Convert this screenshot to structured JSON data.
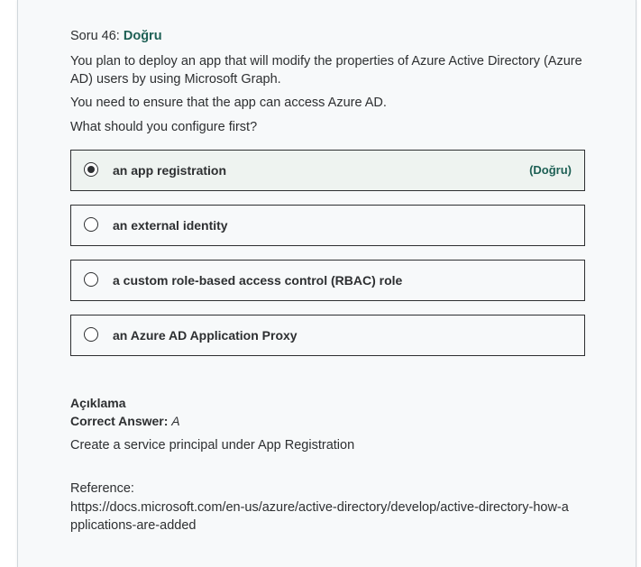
{
  "question": {
    "number_label": "Soru 46:",
    "status": "Doğru",
    "paragraphs": [
      "You plan to deploy an app that will modify the properties of Azure Active Directory (Azure AD) users by using Microsoft Graph.",
      "You need to ensure that the app can access Azure AD.",
      "What should you configure first?"
    ]
  },
  "options": [
    {
      "label": "an app registration",
      "tag": "(Doğru)",
      "selected": true
    },
    {
      "label": "an external identity",
      "selected": false
    },
    {
      "label": "a custom role-based access control (RBAC) role",
      "selected": false
    },
    {
      "label": "an Azure AD Application Proxy",
      "selected": false
    }
  ],
  "explanation": {
    "title": "Açıklama",
    "correct_answer_label": "Correct Answer:",
    "correct_answer_value": "A",
    "text": "Create a service principal under App Registration",
    "reference_label": "Reference:",
    "reference_url": "https://docs.microsoft.com/en-us/azure/active-directory/develop/active-directory-how-applications-are-added"
  },
  "colors": {
    "correct_green": "#1e6055",
    "text": "#2d2f31",
    "panel_bg": "#f7f9fa"
  }
}
